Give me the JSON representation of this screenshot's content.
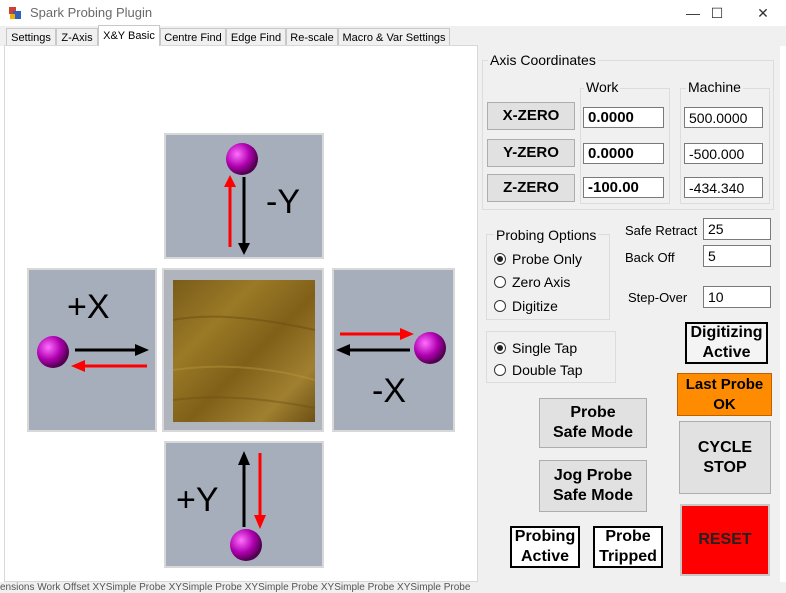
{
  "window": {
    "title": "Spark Probing Plugin",
    "minimize": "—",
    "maximize": "☐",
    "close": "✕"
  },
  "tabs": [
    {
      "label": "Settings"
    },
    {
      "label": "Z-Axis"
    },
    {
      "label": "X&Y Basic"
    },
    {
      "label": "Centre Find"
    },
    {
      "label": "Edge Find"
    },
    {
      "label": "Re-scale"
    },
    {
      "label": "Macro & Var Settings"
    }
  ],
  "jog": {
    "minus_y": "-Y",
    "plus_x": "+X",
    "minus_x": "-X",
    "plus_y": "+Y"
  },
  "axis": {
    "title": "Axis Coordinates",
    "work_title": "Work",
    "machine_title": "Machine",
    "x_zero": "X-ZERO",
    "y_zero": "Y-ZERO",
    "z_zero": "Z-ZERO",
    "work_x": "0.0000",
    "work_y": "0.0000",
    "work_z": "-100.00",
    "mach_x": "500.0000",
    "mach_y": "-500.000",
    "mach_z": "-434.340"
  },
  "probing_options": {
    "title": "Probing Options",
    "probe_only": "Probe Only",
    "zero_axis": "Zero Axis",
    "digitize": "Digitize",
    "selected": "Probe Only"
  },
  "tap": {
    "single": "Single Tap",
    "double": "Double Tap",
    "selected": "Single Tap"
  },
  "params": {
    "safe_retract_label": "Safe Retract",
    "safe_retract": "25",
    "back_off_label": "Back Off",
    "back_off": "5",
    "step_over_label": "Step-Over",
    "step_over": "10"
  },
  "buttons": {
    "probe_safe_1": "Probe",
    "probe_safe_2": "Safe Mode",
    "jog_probe_1": "Jog Probe",
    "jog_probe_2": "Safe Mode",
    "cycle_1": "CYCLE",
    "cycle_2": "STOP",
    "reset": "RESET"
  },
  "status": {
    "digitizing_1": "Digitizing",
    "digitizing_2": "Active",
    "last_probe_1": "Last Probe",
    "last_probe_2": "OK",
    "probing_1": "Probing",
    "probing_2": "Active",
    "tripped_1": "Probe",
    "tripped_2": "Tripped"
  },
  "taskbar_text": "ensions     Work Offset      XYSimple Probe     XYSimple Probe     XYSimple Probe     XYSimple Probe     XYSimple Probe",
  "colors": {
    "last_probe_bg": "#ff8c00",
    "reset_bg": "#ff0000",
    "probe_ball": "#b000b0",
    "workpiece": "#8a6a1e",
    "tile": "#a7aebb"
  }
}
